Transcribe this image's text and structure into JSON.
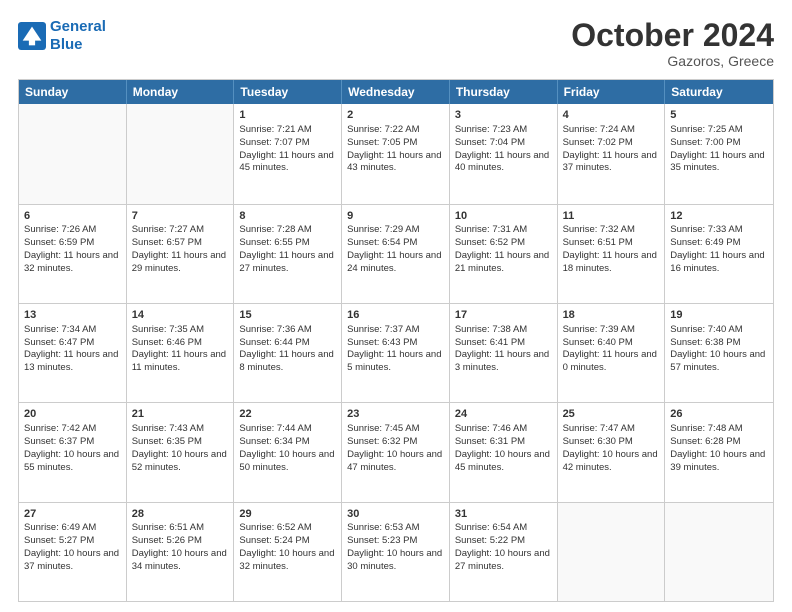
{
  "logo": {
    "line1": "General",
    "line2": "Blue"
  },
  "title": "October 2024",
  "subtitle": "Gazoros, Greece",
  "header_days": [
    "Sunday",
    "Monday",
    "Tuesday",
    "Wednesday",
    "Thursday",
    "Friday",
    "Saturday"
  ],
  "weeks": [
    [
      {
        "day": "",
        "info": "",
        "empty": true
      },
      {
        "day": "",
        "info": "",
        "empty": true
      },
      {
        "day": "1",
        "info": "Sunrise: 7:21 AM\nSunset: 7:07 PM\nDaylight: 11 hours and 45 minutes.",
        "empty": false
      },
      {
        "day": "2",
        "info": "Sunrise: 7:22 AM\nSunset: 7:05 PM\nDaylight: 11 hours and 43 minutes.",
        "empty": false
      },
      {
        "day": "3",
        "info": "Sunrise: 7:23 AM\nSunset: 7:04 PM\nDaylight: 11 hours and 40 minutes.",
        "empty": false
      },
      {
        "day": "4",
        "info": "Sunrise: 7:24 AM\nSunset: 7:02 PM\nDaylight: 11 hours and 37 minutes.",
        "empty": false
      },
      {
        "day": "5",
        "info": "Sunrise: 7:25 AM\nSunset: 7:00 PM\nDaylight: 11 hours and 35 minutes.",
        "empty": false
      }
    ],
    [
      {
        "day": "6",
        "info": "Sunrise: 7:26 AM\nSunset: 6:59 PM\nDaylight: 11 hours and 32 minutes.",
        "empty": false
      },
      {
        "day": "7",
        "info": "Sunrise: 7:27 AM\nSunset: 6:57 PM\nDaylight: 11 hours and 29 minutes.",
        "empty": false
      },
      {
        "day": "8",
        "info": "Sunrise: 7:28 AM\nSunset: 6:55 PM\nDaylight: 11 hours and 27 minutes.",
        "empty": false
      },
      {
        "day": "9",
        "info": "Sunrise: 7:29 AM\nSunset: 6:54 PM\nDaylight: 11 hours and 24 minutes.",
        "empty": false
      },
      {
        "day": "10",
        "info": "Sunrise: 7:31 AM\nSunset: 6:52 PM\nDaylight: 11 hours and 21 minutes.",
        "empty": false
      },
      {
        "day": "11",
        "info": "Sunrise: 7:32 AM\nSunset: 6:51 PM\nDaylight: 11 hours and 18 minutes.",
        "empty": false
      },
      {
        "day": "12",
        "info": "Sunrise: 7:33 AM\nSunset: 6:49 PM\nDaylight: 11 hours and 16 minutes.",
        "empty": false
      }
    ],
    [
      {
        "day": "13",
        "info": "Sunrise: 7:34 AM\nSunset: 6:47 PM\nDaylight: 11 hours and 13 minutes.",
        "empty": false
      },
      {
        "day": "14",
        "info": "Sunrise: 7:35 AM\nSunset: 6:46 PM\nDaylight: 11 hours and 11 minutes.",
        "empty": false
      },
      {
        "day": "15",
        "info": "Sunrise: 7:36 AM\nSunset: 6:44 PM\nDaylight: 11 hours and 8 minutes.",
        "empty": false
      },
      {
        "day": "16",
        "info": "Sunrise: 7:37 AM\nSunset: 6:43 PM\nDaylight: 11 hours and 5 minutes.",
        "empty": false
      },
      {
        "day": "17",
        "info": "Sunrise: 7:38 AM\nSunset: 6:41 PM\nDaylight: 11 hours and 3 minutes.",
        "empty": false
      },
      {
        "day": "18",
        "info": "Sunrise: 7:39 AM\nSunset: 6:40 PM\nDaylight: 11 hours and 0 minutes.",
        "empty": false
      },
      {
        "day": "19",
        "info": "Sunrise: 7:40 AM\nSunset: 6:38 PM\nDaylight: 10 hours and 57 minutes.",
        "empty": false
      }
    ],
    [
      {
        "day": "20",
        "info": "Sunrise: 7:42 AM\nSunset: 6:37 PM\nDaylight: 10 hours and 55 minutes.",
        "empty": false
      },
      {
        "day": "21",
        "info": "Sunrise: 7:43 AM\nSunset: 6:35 PM\nDaylight: 10 hours and 52 minutes.",
        "empty": false
      },
      {
        "day": "22",
        "info": "Sunrise: 7:44 AM\nSunset: 6:34 PM\nDaylight: 10 hours and 50 minutes.",
        "empty": false
      },
      {
        "day": "23",
        "info": "Sunrise: 7:45 AM\nSunset: 6:32 PM\nDaylight: 10 hours and 47 minutes.",
        "empty": false
      },
      {
        "day": "24",
        "info": "Sunrise: 7:46 AM\nSunset: 6:31 PM\nDaylight: 10 hours and 45 minutes.",
        "empty": false
      },
      {
        "day": "25",
        "info": "Sunrise: 7:47 AM\nSunset: 6:30 PM\nDaylight: 10 hours and 42 minutes.",
        "empty": false
      },
      {
        "day": "26",
        "info": "Sunrise: 7:48 AM\nSunset: 6:28 PM\nDaylight: 10 hours and 39 minutes.",
        "empty": false
      }
    ],
    [
      {
        "day": "27",
        "info": "Sunrise: 6:49 AM\nSunset: 5:27 PM\nDaylight: 10 hours and 37 minutes.",
        "empty": false
      },
      {
        "day": "28",
        "info": "Sunrise: 6:51 AM\nSunset: 5:26 PM\nDaylight: 10 hours and 34 minutes.",
        "empty": false
      },
      {
        "day": "29",
        "info": "Sunrise: 6:52 AM\nSunset: 5:24 PM\nDaylight: 10 hours and 32 minutes.",
        "empty": false
      },
      {
        "day": "30",
        "info": "Sunrise: 6:53 AM\nSunset: 5:23 PM\nDaylight: 10 hours and 30 minutes.",
        "empty": false
      },
      {
        "day": "31",
        "info": "Sunrise: 6:54 AM\nSunset: 5:22 PM\nDaylight: 10 hours and 27 minutes.",
        "empty": false
      },
      {
        "day": "",
        "info": "",
        "empty": true
      },
      {
        "day": "",
        "info": "",
        "empty": true
      }
    ]
  ]
}
